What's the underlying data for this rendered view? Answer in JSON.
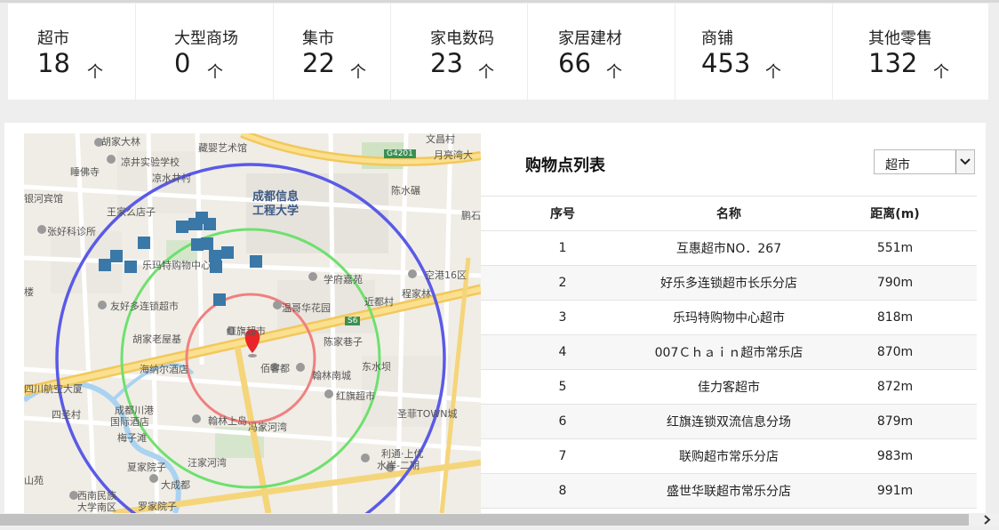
{
  "stats": [
    {
      "label": "超市",
      "value": "18",
      "unit": "个"
    },
    {
      "label": "大型商场",
      "value": "0",
      "unit": "个"
    },
    {
      "label": "集市",
      "value": "22",
      "unit": "个"
    },
    {
      "label": "家电数码",
      "value": "23",
      "unit": "个"
    },
    {
      "label": "家居建材",
      "value": "66",
      "unit": "个"
    },
    {
      "label": "商铺",
      "value": "453",
      "unit": "个"
    },
    {
      "label": "其他零售",
      "value": "132",
      "unit": "个"
    }
  ],
  "map": {
    "labels": {
      "m1": "红旗超市",
      "m2": "胡家大林",
      "m3": "藏婴艺术馆",
      "m4": "文昌村",
      "m5": "月亮湾大",
      "m6": "睡佛寺",
      "m7": "凉井实验学校",
      "m8": "凉水井村",
      "m9": "成都信息",
      "m10": "工程大学",
      "m11": "陈水碾",
      "m12": "银河宾馆",
      "m13": "王家么店子",
      "m14": "张好科诊所",
      "m15": "乐玛特购物中心",
      "m16": "学府嘉苑",
      "m17": "空港16区",
      "m18": "楼",
      "m19": "程家林",
      "m20": "近都村",
      "m21": "友好多连锁超市",
      "m22": "温哥华花园",
      "m23": "红旗超市",
      "m24": "胡家老屋基",
      "m25": "陈家巷子",
      "m26": "海纳尔酒店",
      "m27": "佰客都",
      "m28": "翰林南城",
      "m29": "东水坝",
      "m30": "四川航空大厦",
      "m31": "红旗超市",
      "m32": "四圣村",
      "m33": "成都川港",
      "m34": "国际酒店",
      "m35": "翰林上岛",
      "m36": "冯家河湾",
      "m37": "圣菲TOWN城",
      "m38": "梅子滩",
      "m39": "利通·上优",
      "m40": "水岸-二期",
      "m41": "汪家河湾",
      "m42": "夏家院子",
      "m43": "大成都",
      "m44": "西南民族",
      "m45": "大学南区",
      "m46": "罗家院子",
      "m47": "山苑",
      "m48": "鹏石"
    },
    "roads": {
      "g4201": "G4201",
      "s6": "S6"
    }
  },
  "list": {
    "title": "购物点列表",
    "select": {
      "value": "超市"
    },
    "headers": {
      "index": "序号",
      "name": "名称",
      "distance": "距离(m)"
    },
    "rows": [
      {
        "index": "1",
        "name": "互惠超市NO．267",
        "distance": "551m"
      },
      {
        "index": "2",
        "name": "好乐多连锁超市长乐分店",
        "distance": "790m"
      },
      {
        "index": "3",
        "name": "乐玛特购物中心超市",
        "distance": "818m"
      },
      {
        "index": "4",
        "name": "007Ｃｈａｉｎ超市常乐店",
        "distance": "870m"
      },
      {
        "index": "5",
        "name": "佳力客超市",
        "distance": "872m"
      },
      {
        "index": "6",
        "name": "红旗连锁双流信息分场",
        "distance": "879m"
      },
      {
        "index": "7",
        "name": "联购超市常乐分店",
        "distance": "983m"
      },
      {
        "index": "8",
        "name": "盛世华联超市常乐分店",
        "distance": "991m"
      }
    ]
  },
  "colors": {
    "ring_outer": "#5a5ae8",
    "ring_middle": "#6ee06e",
    "ring_inner": "#f08080",
    "marker": "#e8262a",
    "poi": "#3a78a8"
  }
}
